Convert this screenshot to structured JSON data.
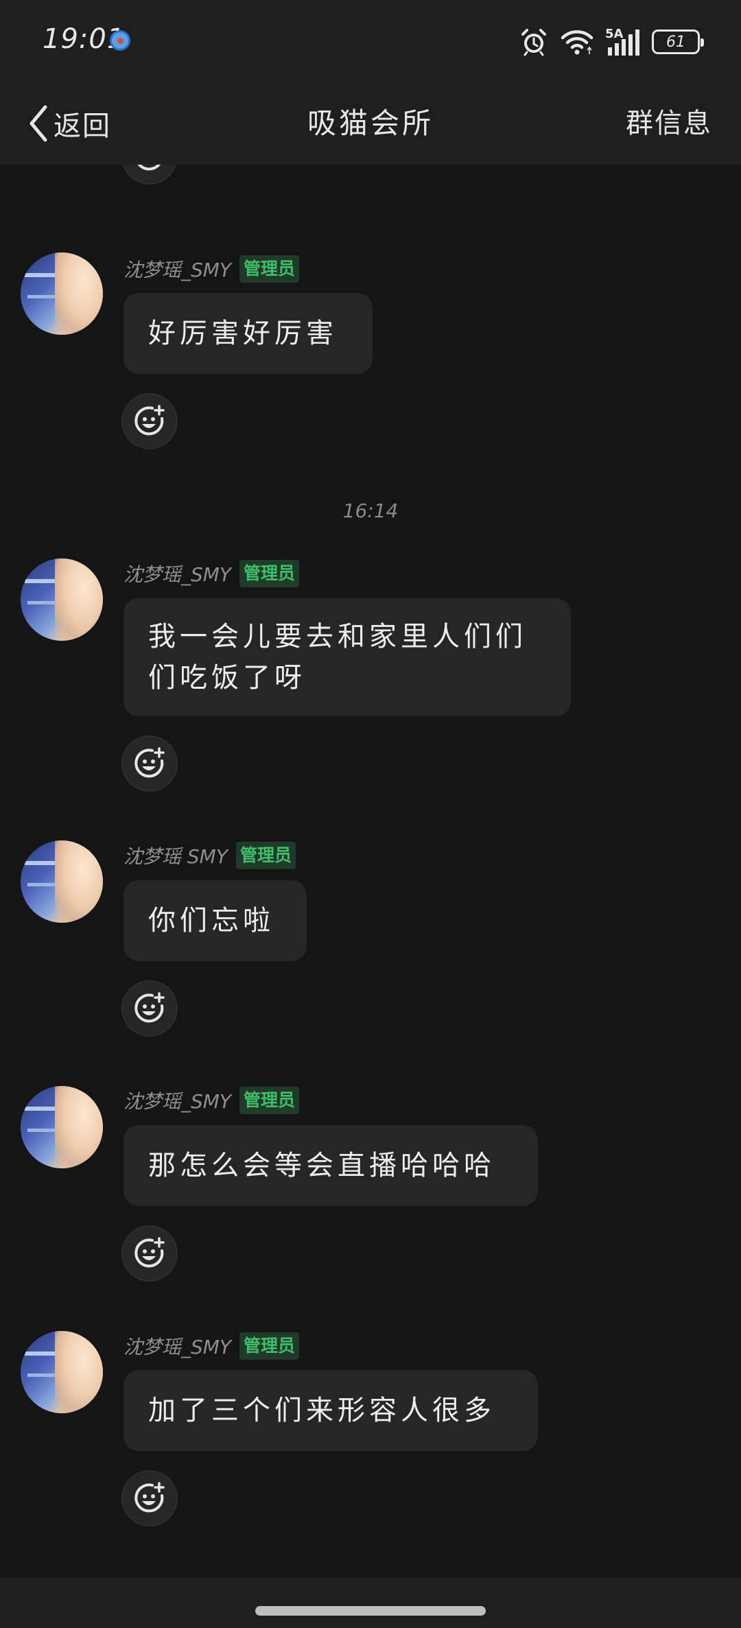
{
  "status_bar": {
    "time": "19:01",
    "network": "5A",
    "battery": "61"
  },
  "nav": {
    "back_label": "返回",
    "title": "吸猫会所",
    "group_info_label": "群信息"
  },
  "colors": {
    "background": "#151515",
    "bubble": "#262626",
    "admin_badge_text": "#3fbf6a",
    "sender_name": "#8f8f8f"
  },
  "chat": {
    "time_divider": "16:14",
    "messages": [
      {
        "sender": "沈梦瑶_SMY",
        "badge": "管理员",
        "text": "好厉害好厉害"
      },
      {
        "sender": "沈梦瑶_SMY",
        "badge": "管理员",
        "text": "我一会儿要去和家里人们们们吃饭了呀"
      },
      {
        "sender": "沈梦瑶 SMY",
        "badge": "管理员",
        "text": "你们忘啦"
      },
      {
        "sender": "沈梦瑶_SMY",
        "badge": "管理员",
        "text": "那怎么会等会直播哈哈哈"
      },
      {
        "sender": "沈梦瑶_SMY",
        "badge": "管理员",
        "text": "加了三个们来形容人很多"
      }
    ]
  },
  "icons": {
    "react": "emoji-add-icon",
    "back": "chevron-left-icon",
    "alarm": "alarm-icon",
    "wifi": "wifi-icon",
    "signal": "signal-icon"
  }
}
